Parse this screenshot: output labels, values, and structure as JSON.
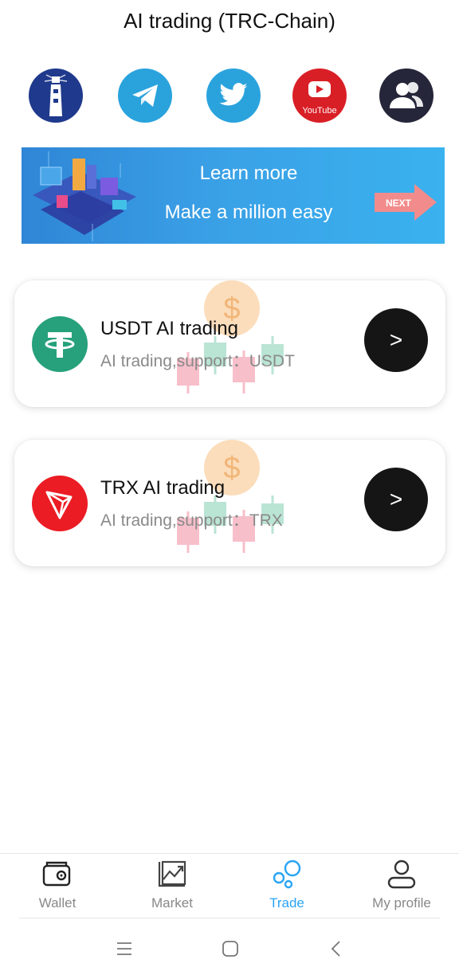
{
  "header": {
    "title": "AI trading (TRC-Chain)"
  },
  "social": [
    {
      "name": "lighthouse-icon",
      "bg": "#1f3a8c"
    },
    {
      "name": "telegram-icon",
      "bg": "#2aa3dd"
    },
    {
      "name": "twitter-icon",
      "bg": "#2aa3dd"
    },
    {
      "name": "youtube-icon",
      "bg": "#d91f26",
      "label": "YouTube"
    },
    {
      "name": "community-icon",
      "bg": "#26263a"
    }
  ],
  "banner": {
    "line1": "Learn more",
    "line2": "Make a million easy",
    "next_label": "NEXT"
  },
  "cards": [
    {
      "title": "USDT AI trading",
      "subtitle": "AI trading,support：USDT",
      "logo": "tether-icon",
      "logo_color": "#26a17b",
      "button_label": ">"
    },
    {
      "title": "TRX AI trading",
      "subtitle": "AI trading,support：TRX",
      "logo": "tron-icon",
      "logo_color": "#eb1c24",
      "button_label": ">"
    }
  ],
  "tabs": [
    {
      "label": "Wallet",
      "icon": "wallet-icon",
      "active": false
    },
    {
      "label": "Market",
      "icon": "market-chart-icon",
      "active": false
    },
    {
      "label": "Trade",
      "icon": "trade-bubbles-icon",
      "active": true
    },
    {
      "label": "My profile",
      "icon": "profile-icon",
      "active": false
    }
  ],
  "colors": {
    "accent": "#2aa4f4",
    "button_dark": "#151515"
  }
}
